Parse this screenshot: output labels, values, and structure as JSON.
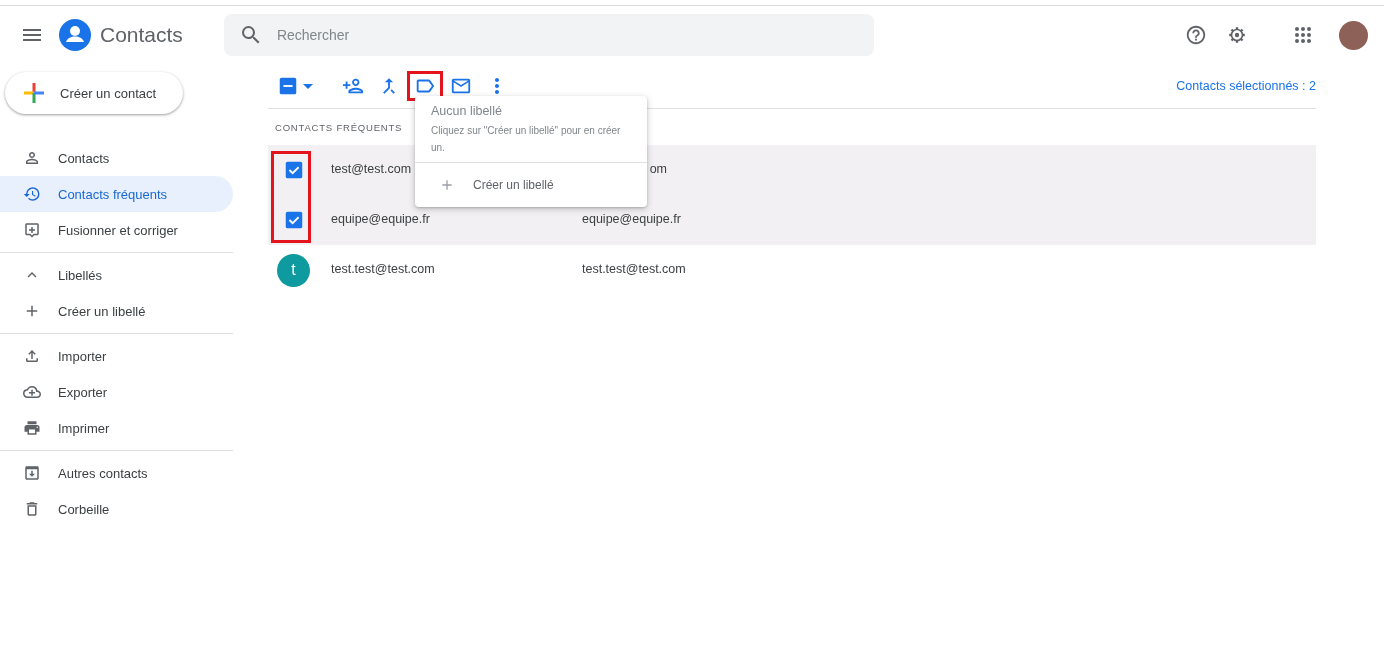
{
  "app": {
    "title": "Contacts"
  },
  "search": {
    "placeholder": "Rechercher"
  },
  "sidebar": {
    "create_button": "Créer un contact",
    "sections": [
      {
        "items": [
          {
            "label": "Contacts",
            "selected": false
          },
          {
            "label": "Contacts fréquents",
            "selected": true
          },
          {
            "label": "Fusionner et corriger",
            "selected": false
          }
        ]
      },
      {
        "heading": {
          "label": "Libellés",
          "expanded": true
        },
        "items": [
          {
            "label": "Créer un libellé",
            "selected": false
          }
        ]
      },
      {
        "items": [
          {
            "label": "Importer",
            "selected": false
          },
          {
            "label": "Exporter",
            "selected": false
          },
          {
            "label": "Imprimer",
            "selected": false
          }
        ]
      },
      {
        "items": [
          {
            "label": "Autres contacts",
            "selected": false
          },
          {
            "label": "Corbeille",
            "selected": false
          }
        ]
      }
    ]
  },
  "toolbar": {
    "select_all": {
      "indeterminate": true
    },
    "actions": [
      {
        "highlighted": false
      },
      {
        "highlighted": false
      },
      {
        "highlighted": true
      },
      {
        "highlighted": false
      },
      {
        "highlighted": false
      }
    ],
    "selection_count": "Contacts sélectionnés : 2"
  },
  "list": {
    "heading": "CONTACTS FRÉQUENTS",
    "checkboxes_highlighted": true,
    "rows": [
      {
        "name": "test@test.com",
        "column_2": "om",
        "column_2_covered": true,
        "selected": true
      },
      {
        "name": "equipe@equipe.fr",
        "column_2": "equipe@equipe.fr",
        "column_2_covered": false,
        "selected": true
      },
      {
        "name": "test.test@test.com",
        "column_2": "test.test@test.com",
        "column_2_covered": false,
        "selected": false,
        "avatar": "t"
      }
    ]
  },
  "label_menu": {
    "title": "Aucun libellé",
    "hint": "Cliquez sur \"Créer un libellé\" pour en créer un.",
    "action": "Créer un libellé"
  }
}
